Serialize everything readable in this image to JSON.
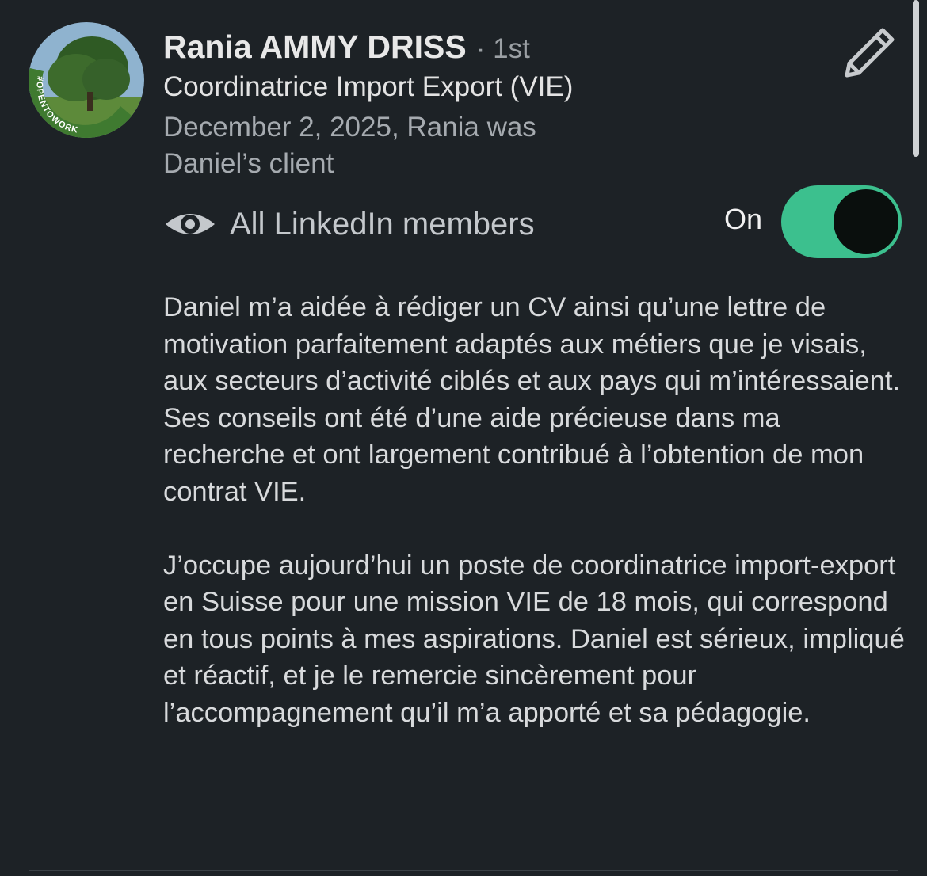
{
  "recommendation": {
    "name": "Rania AMMY DRISS",
    "degree": "· 1st",
    "headline": "Coordinatrice Import Export (VIE)",
    "meta_line1": "December 2, 2025, Rania was",
    "meta_line2": "Daniel’s client",
    "avatar_badge": "#OPENTOWORK",
    "avatar_ring_color": "#3a6b2d"
  },
  "visibility": {
    "icon": "eye-icon",
    "label": "All LinkedIn members",
    "state_label": "On",
    "enabled": true,
    "toggle_color": "#3cc08e"
  },
  "edit_icon": "pencil-icon",
  "body": {
    "paragraph1": "Daniel m’a aidée à rédiger un CV ainsi qu’une lettre de motivation parfaitement adaptés aux métiers que je visais, aux secteurs d’activité ciblés et aux pays qui m’intéressaient. Ses conseils ont été d’une aide précieuse dans ma recherche et ont largement contribué à l’obtention de mon contrat VIE.",
    "paragraph2": "J’occupe aujourd’hui un poste de coordinatrice import-export en Suisse pour une mission VIE de 18 mois, qui correspond en tous points à mes aspirations. Daniel est sérieux, impliqué et réactif, et je le remercie sincèrement pour l’accompagnement qu’il m’a apporté et sa pédagogie."
  }
}
